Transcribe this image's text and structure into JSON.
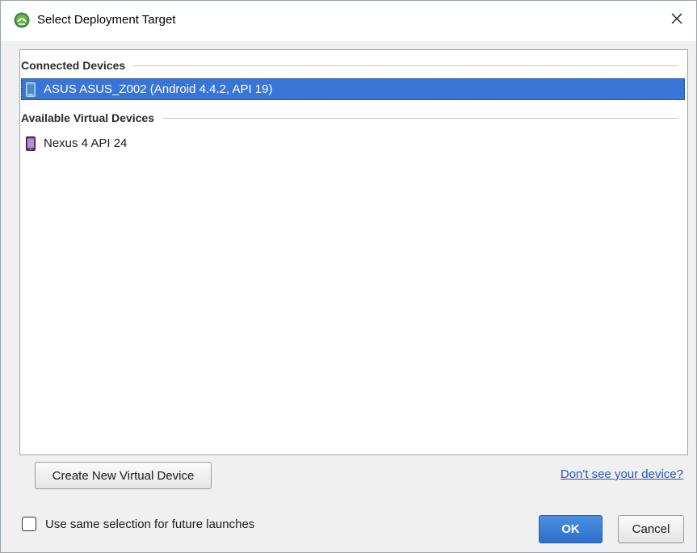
{
  "window": {
    "title": "Select Deployment Target",
    "icon": "android-studio-icon",
    "close_icon": "close-icon"
  },
  "device_list": {
    "groups": [
      {
        "header": "Connected Devices",
        "devices": [
          {
            "name": "ASUS ASUS_Z002 (Android 4.4.2, API 19)",
            "icon": "phone-device-icon",
            "selected": true
          }
        ]
      },
      {
        "header": "Available Virtual Devices",
        "devices": [
          {
            "name": "Nexus 4 API 24",
            "icon": "virtual-device-icon",
            "selected": false
          }
        ]
      }
    ]
  },
  "actions": {
    "create_label": "Create New Virtual Device",
    "help_link": "Don't see your device?",
    "remember_label": "Use same selection for future launches",
    "remember_checked": false,
    "ok_label": "OK",
    "cancel_label": "Cancel"
  },
  "colors": {
    "selection": "#3875d7",
    "link": "#2953c2",
    "ok_button": "#3a7fd9"
  }
}
